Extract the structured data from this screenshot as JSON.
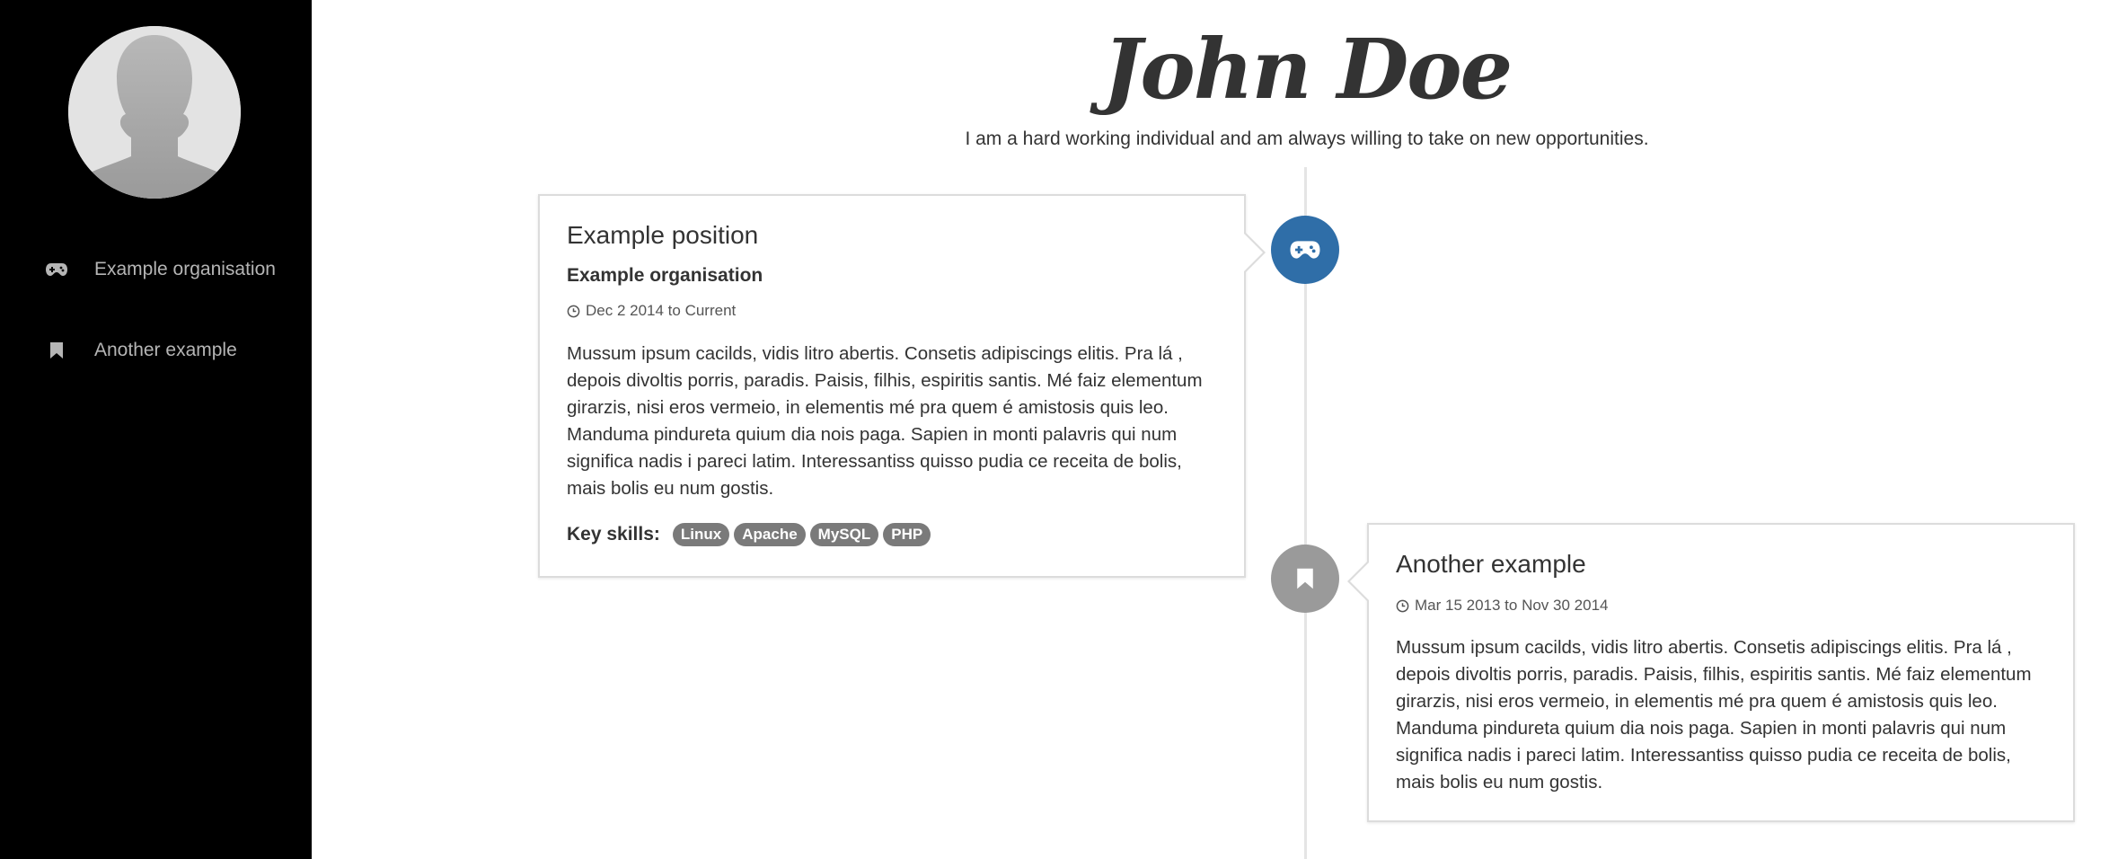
{
  "sidebar": {
    "items": [
      {
        "label": "Example organisation",
        "icon": "gamepad-icon"
      },
      {
        "label": "Another example",
        "icon": "bookmark-icon"
      }
    ]
  },
  "header": {
    "name": "John Doe",
    "tagline": "I am a hard working individual and am always willing to take on new opportunities."
  },
  "timeline": {
    "entries": [
      {
        "title": "Example position",
        "organisation": "Example organisation",
        "date": "Dec 2 2014 to Current",
        "description": "Mussum ipsum cacilds, vidis litro abertis. Consetis adipiscings elitis. Pra lá , depois divoltis porris, paradis. Paisis, filhis, espiritis santis. Mé faiz elementum girarzis, nisi eros vermeio, in elementis mé pra quem é amistosis quis leo. Manduma pindureta quium dia nois paga. Sapien in monti palavris qui num significa nadis i pareci latim. Interessantiss quisso pudia ce receita de bolis, mais bolis eu num gostis.",
        "skills_label": "Key skills:",
        "skills": [
          "Linux",
          "Apache",
          "MySQL",
          "PHP"
        ],
        "marker_icon": "gamepad-icon",
        "marker_color": "#2f6ea8"
      },
      {
        "title": "Another example",
        "date": "Mar 15 2013 to Nov 30 2014",
        "description": "Mussum ipsum cacilds, vidis litro abertis. Consetis adipiscings elitis. Pra lá , depois divoltis porris, paradis. Paisis, filhis, espiritis santis. Mé faiz elementum girarzis, nisi eros vermeio, in elementis mé pra quem é amistosis quis leo. Manduma pindureta quium dia nois paga. Sapien in monti palavris qui num significa nadis i pareci latim. Interessantiss quisso pudia ce receita de bolis, mais bolis eu num gostis.",
        "marker_icon": "bookmark-icon",
        "marker_color": "#9a9a9a"
      }
    ]
  },
  "colors": {
    "sidebar_bg": "#000000",
    "accent": "#2f6ea8",
    "badge_bg": "#7a7a7a"
  }
}
